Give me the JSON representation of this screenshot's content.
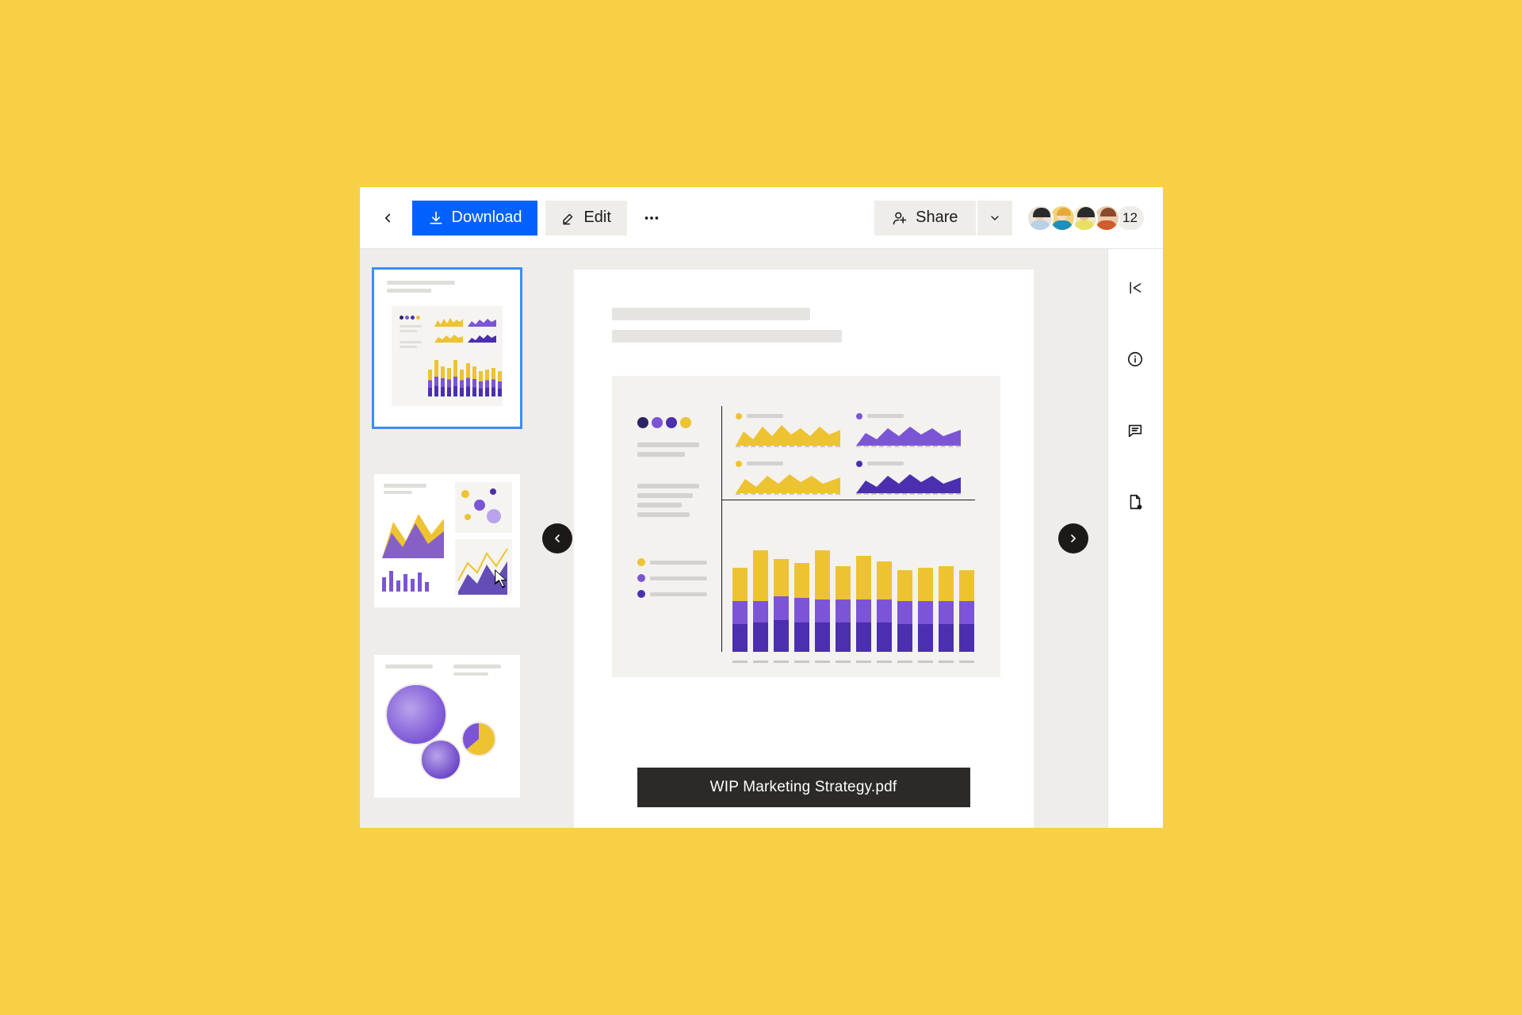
{
  "toolbar": {
    "download_label": "Download",
    "edit_label": "Edit",
    "share_label": "Share"
  },
  "facepile": {
    "count": "12",
    "avatars": [
      {
        "skin": "#f1c9a8",
        "hair": "#2a2a2a",
        "shirt": "#b9d0e6"
      },
      {
        "skin": "#f6dcc0",
        "hair": "#e6aa3a",
        "shirt": "#1f8fbf"
      },
      {
        "skin": "#e8b98e",
        "hair": "#2a2a2a",
        "shirt": "#e8e060"
      },
      {
        "skin": "#f1c9a8",
        "hair": "#8a4a2a",
        "shirt": "#d25a2d"
      }
    ]
  },
  "preview": {
    "filename": "WIP Marketing Strategy.pdf"
  },
  "colors": {
    "yellow": "#eec332",
    "purple_dark": "#4b2fae",
    "purple_mid": "#7b55d6",
    "purple_light": "#b9a4ec",
    "grey": "#d4d2cf"
  },
  "chart_data": {
    "sparklines": [
      {
        "dot_color": "#eec332",
        "series_color": "#eec332",
        "type": "area"
      },
      {
        "dot_color": "#7b55d6",
        "series_color": "#7b55d6",
        "type": "area"
      },
      {
        "dot_color": "#eec332",
        "series_color": "#eec332",
        "type": "area"
      },
      {
        "dot_color": "#4b2fae",
        "series_color": "#4b2fae",
        "type": "area"
      }
    ],
    "stacked_bars": {
      "type": "bar",
      "count": 12,
      "segments": [
        "yellow",
        "purple_mid",
        "purple_dark"
      ],
      "bars": [
        {
          "y": 38,
          "m": 26,
          "d": 32
        },
        {
          "y": 58,
          "m": 24,
          "d": 34
        },
        {
          "y": 42,
          "m": 28,
          "d": 36
        },
        {
          "y": 40,
          "m": 28,
          "d": 34
        },
        {
          "y": 56,
          "m": 26,
          "d": 34
        },
        {
          "y": 38,
          "m": 26,
          "d": 34
        },
        {
          "y": 50,
          "m": 26,
          "d": 34
        },
        {
          "y": 44,
          "m": 26,
          "d": 34
        },
        {
          "y": 36,
          "m": 26,
          "d": 32
        },
        {
          "y": 38,
          "m": 26,
          "d": 32
        },
        {
          "y": 40,
          "m": 26,
          "d": 32
        },
        {
          "y": 36,
          "m": 26,
          "d": 32
        }
      ]
    },
    "legend_dots": [
      "#eec332",
      "#7b55d6",
      "#4b2fae"
    ],
    "header_dots": [
      "#2e2365",
      "#7b55d6",
      "#4b2fae",
      "#eec332"
    ]
  }
}
